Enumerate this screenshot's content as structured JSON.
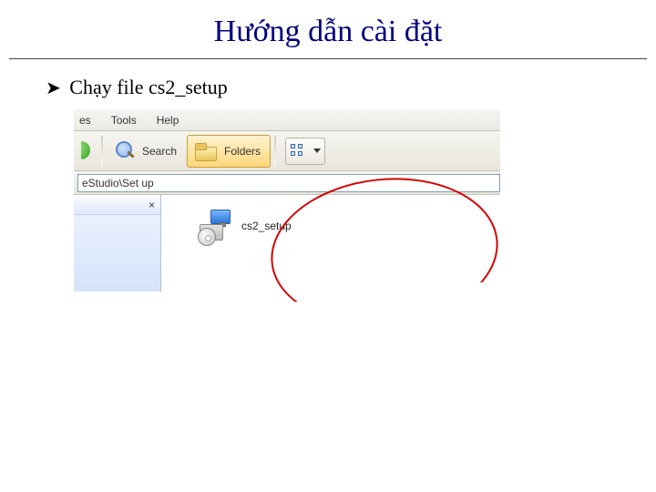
{
  "title": "Hướng dẫn cài đặt",
  "bullet": {
    "marker": "➤",
    "text": "Chạy file cs2_setup"
  },
  "explorer": {
    "menu": {
      "item1_fragment": "es",
      "item2": "Tools",
      "item3": "Help"
    },
    "toolbar": {
      "search_label": "Search",
      "folders_label": "Folders"
    },
    "address_fragment": "eStudio\\Set up",
    "taskpane_close": "×",
    "file": {
      "name": "cs2_setup"
    }
  }
}
